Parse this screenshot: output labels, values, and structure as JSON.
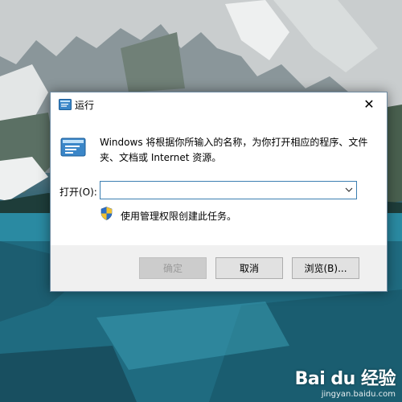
{
  "dialog": {
    "title": "运行",
    "description": "Windows 将根据你所输入的名称，为你打开相应的程序、文件夹、文档或 Internet 资源。",
    "open_label": "打开(O):",
    "open_value": "",
    "admin_note": "使用管理权限创建此任务。",
    "buttons": {
      "ok": "确定",
      "cancel": "取消",
      "browse": "浏览(B)..."
    },
    "close_glyph": "✕"
  },
  "watermark": {
    "logo": "Bai du 经验",
    "url": "jingyan.baidu.com"
  },
  "colors": {
    "combo_border": "#3c7fb1",
    "footer_bg": "#f0f0f0",
    "button_bg": "#e1e1e1",
    "button_disabled_text": "#9a9a9a"
  },
  "icons": [
    "run-program-icon",
    "close-icon",
    "chevron-down-icon",
    "uac-shield-icon"
  ]
}
